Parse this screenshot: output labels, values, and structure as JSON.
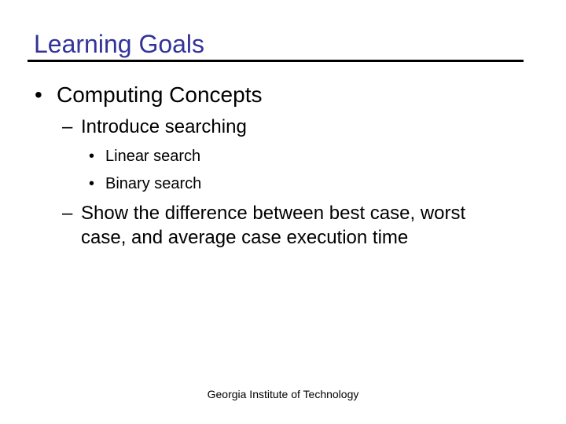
{
  "slide": {
    "title": "Learning Goals",
    "bullets": [
      {
        "bullet": "•",
        "text": "Computing Concepts"
      },
      {
        "bullet": "–",
        "text": "Introduce searching"
      },
      {
        "bullet": "•",
        "text": "Linear search"
      },
      {
        "bullet": "•",
        "text": "Binary search"
      },
      {
        "bullet": "–",
        "text_line1": "Show the difference between best case, worst",
        "text_line2": "case, and average case execution time"
      }
    ],
    "footer": "Georgia Institute of Technology",
    "title_color": "#333399"
  }
}
